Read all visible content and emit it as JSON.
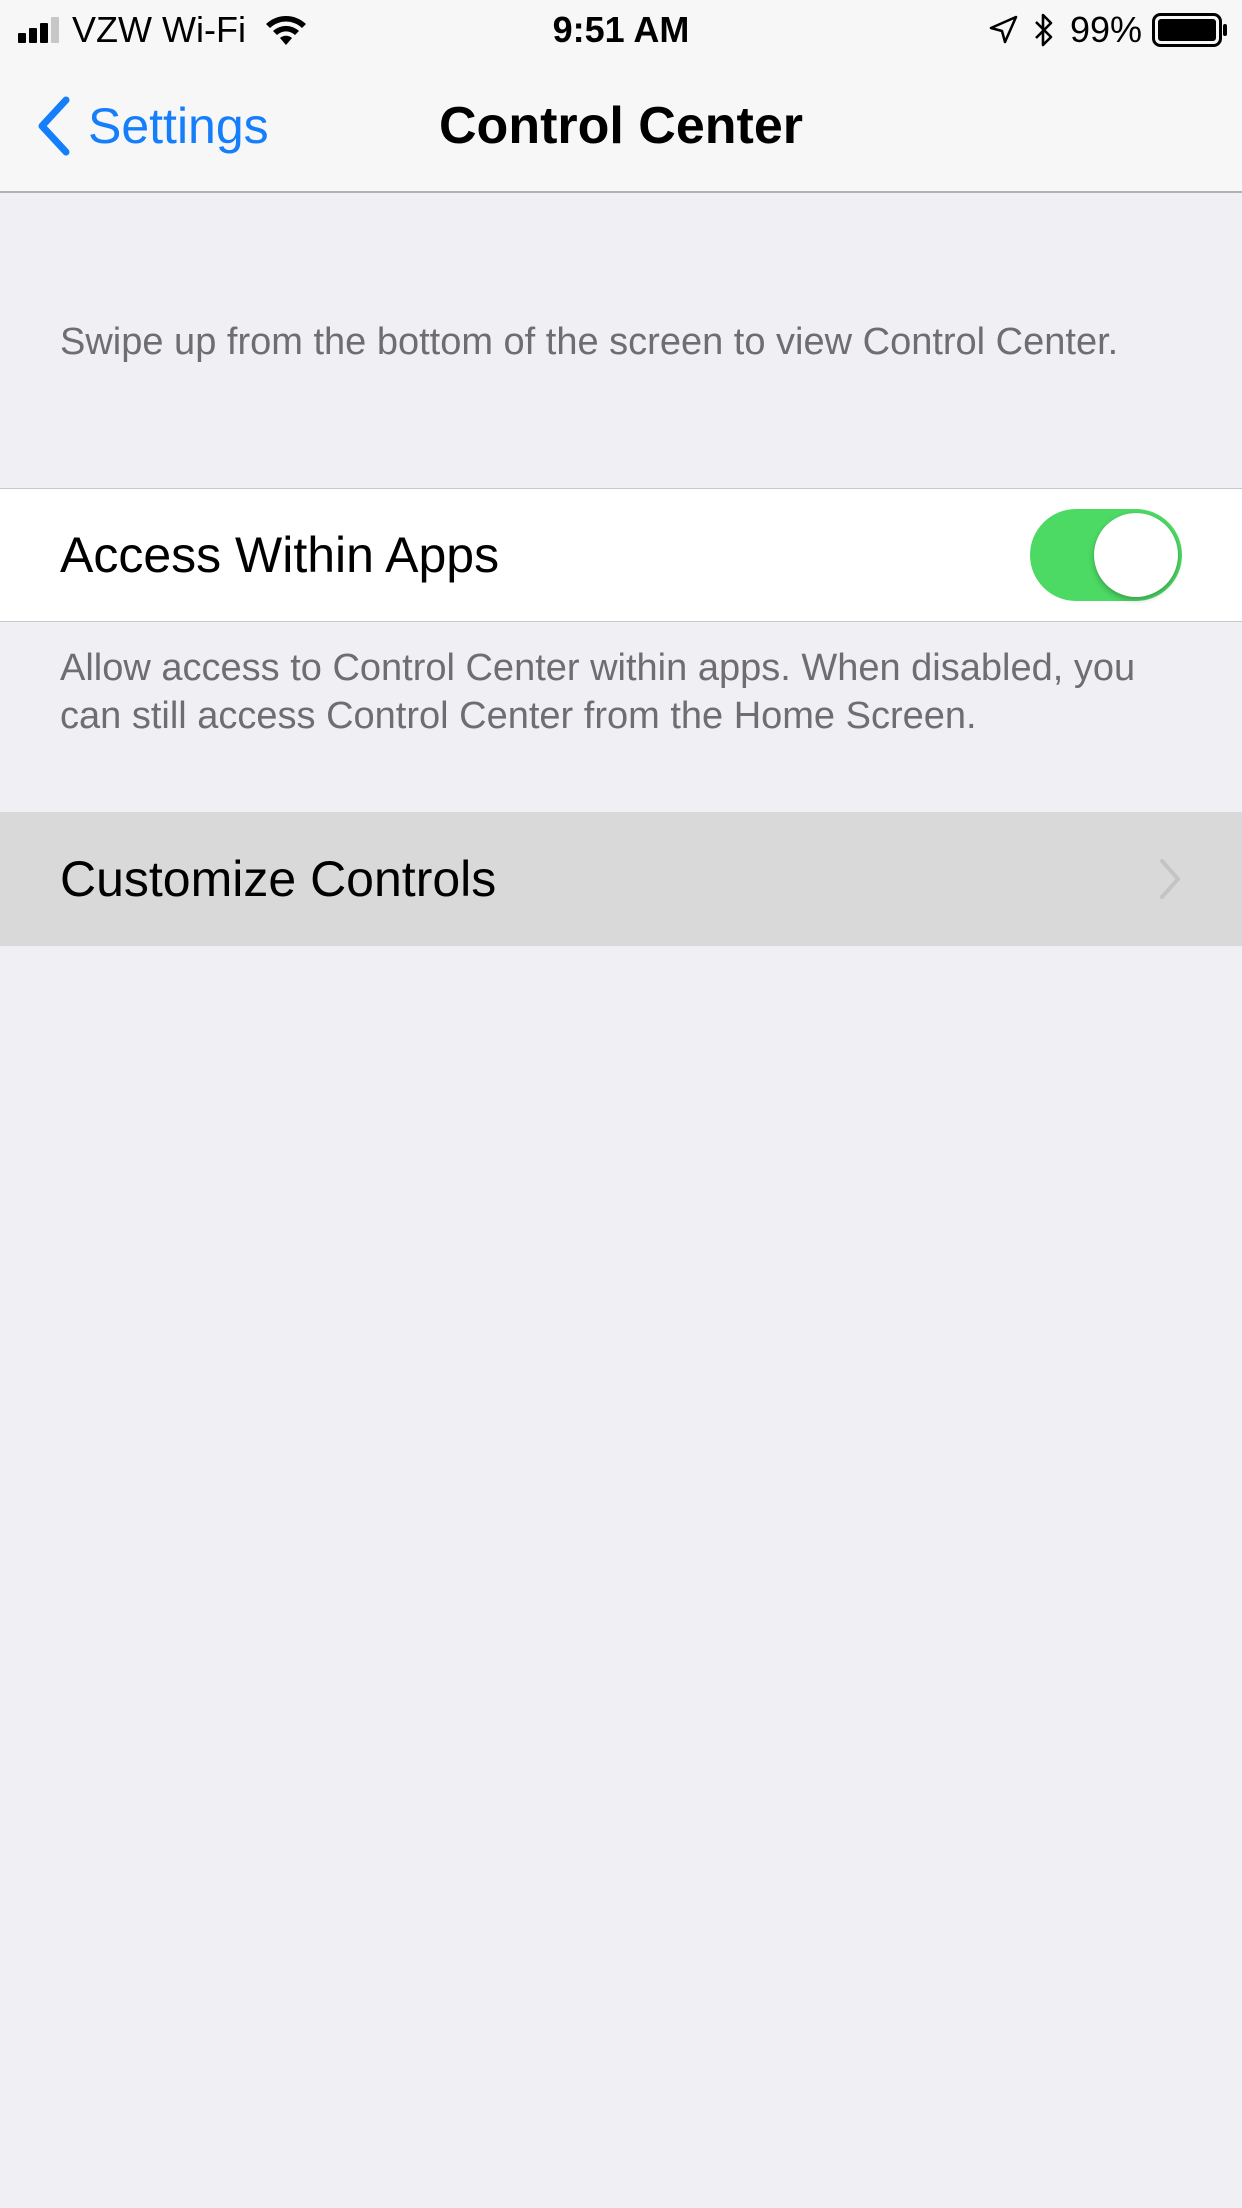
{
  "status_bar": {
    "carrier": "VZW Wi-Fi",
    "time": "9:51 AM",
    "battery_percent": "99%",
    "icons": [
      "signal-bars-icon",
      "wifi-icon",
      "location-arrow-icon",
      "bluetooth-icon",
      "battery-icon"
    ]
  },
  "nav": {
    "back_label": "Settings",
    "title": "Control Center"
  },
  "header_description": "Swipe up from the bottom of the screen to view Control Center.",
  "access_within_apps": {
    "label": "Access Within Apps",
    "enabled": true,
    "toggle_color": "#4cd964"
  },
  "footer_description": "Allow access to Control Center within apps. When disabled, you can still access Control Center from the Home Screen.",
  "customize_controls": {
    "label": "Customize Controls"
  },
  "colors": {
    "accent": "#157efb",
    "background": "#efeff4",
    "secondary_text": "#6d6d72"
  }
}
